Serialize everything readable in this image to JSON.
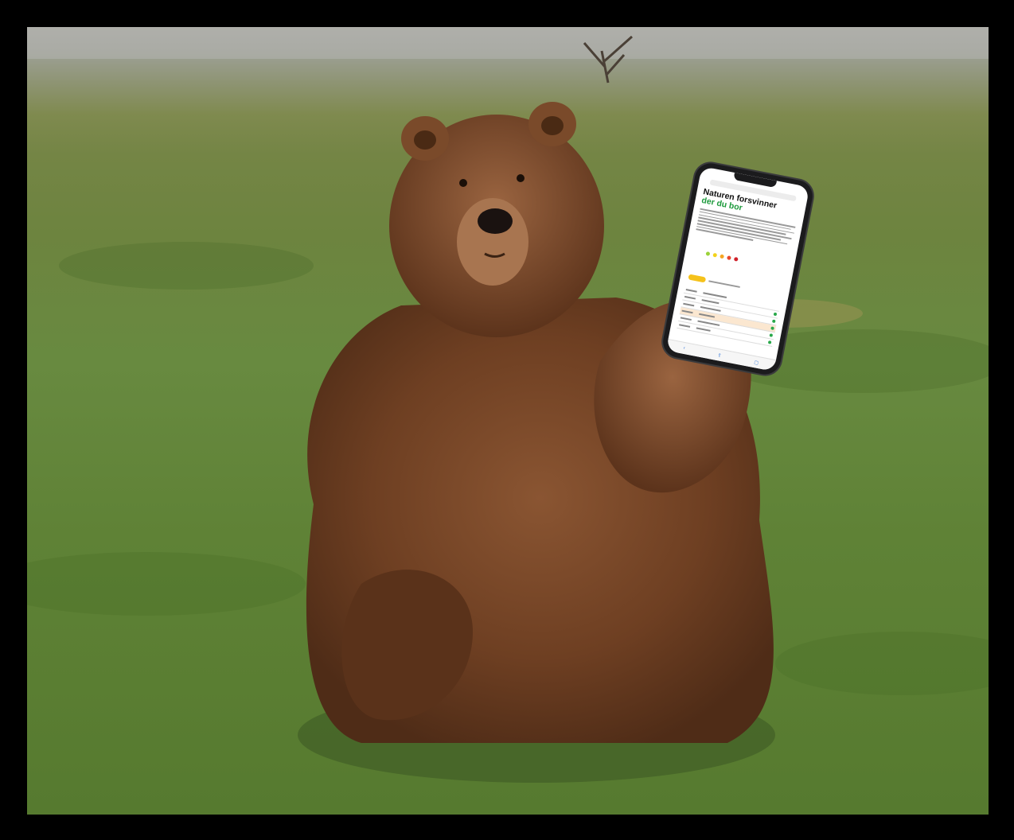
{
  "scene": {
    "subject": "brown-bear",
    "held_object": "smartphone"
  },
  "phone": {
    "headline_line1": "Naturen forsvinner",
    "headline_line2": "der du bor",
    "scale_colors": [
      "#9bd23a",
      "#f2d21b",
      "#f5a623",
      "#e8472c",
      "#d0202a"
    ],
    "accent_color": "#1d9a3c",
    "highlight_color": "#f5c21b",
    "icons": [
      "back-icon",
      "share-icon",
      "tabs-icon"
    ]
  }
}
